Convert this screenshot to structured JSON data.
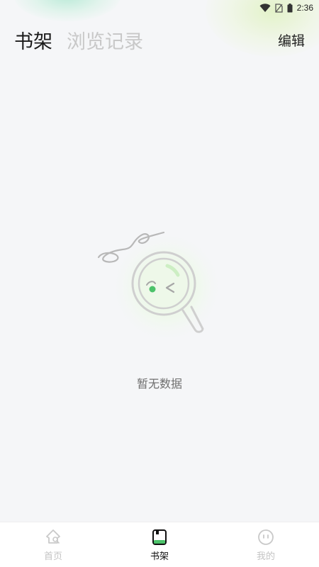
{
  "status_bar": {
    "time": "2:36",
    "icons": [
      "wifi-icon",
      "no-sim-icon",
      "battery-icon"
    ]
  },
  "header": {
    "tabs": [
      {
        "label": "书架",
        "active": true
      },
      {
        "label": "浏览记录",
        "active": false
      }
    ],
    "edit_label": "编辑"
  },
  "empty_state": {
    "icon": "magnifier-face-illustration",
    "message": "暂无数据"
  },
  "bottom_nav": {
    "items": [
      {
        "label": "首页",
        "icon": "home-icon",
        "active": false
      },
      {
        "label": "书架",
        "icon": "bookshelf-icon",
        "active": true
      },
      {
        "label": "我的",
        "icon": "profile-face-icon",
        "active": false
      }
    ]
  },
  "colors": {
    "background": "#f5f6f8",
    "accent_green": "#4cc26a",
    "active_text": "#1a1a1a",
    "inactive_text": "#c8c8c8"
  }
}
